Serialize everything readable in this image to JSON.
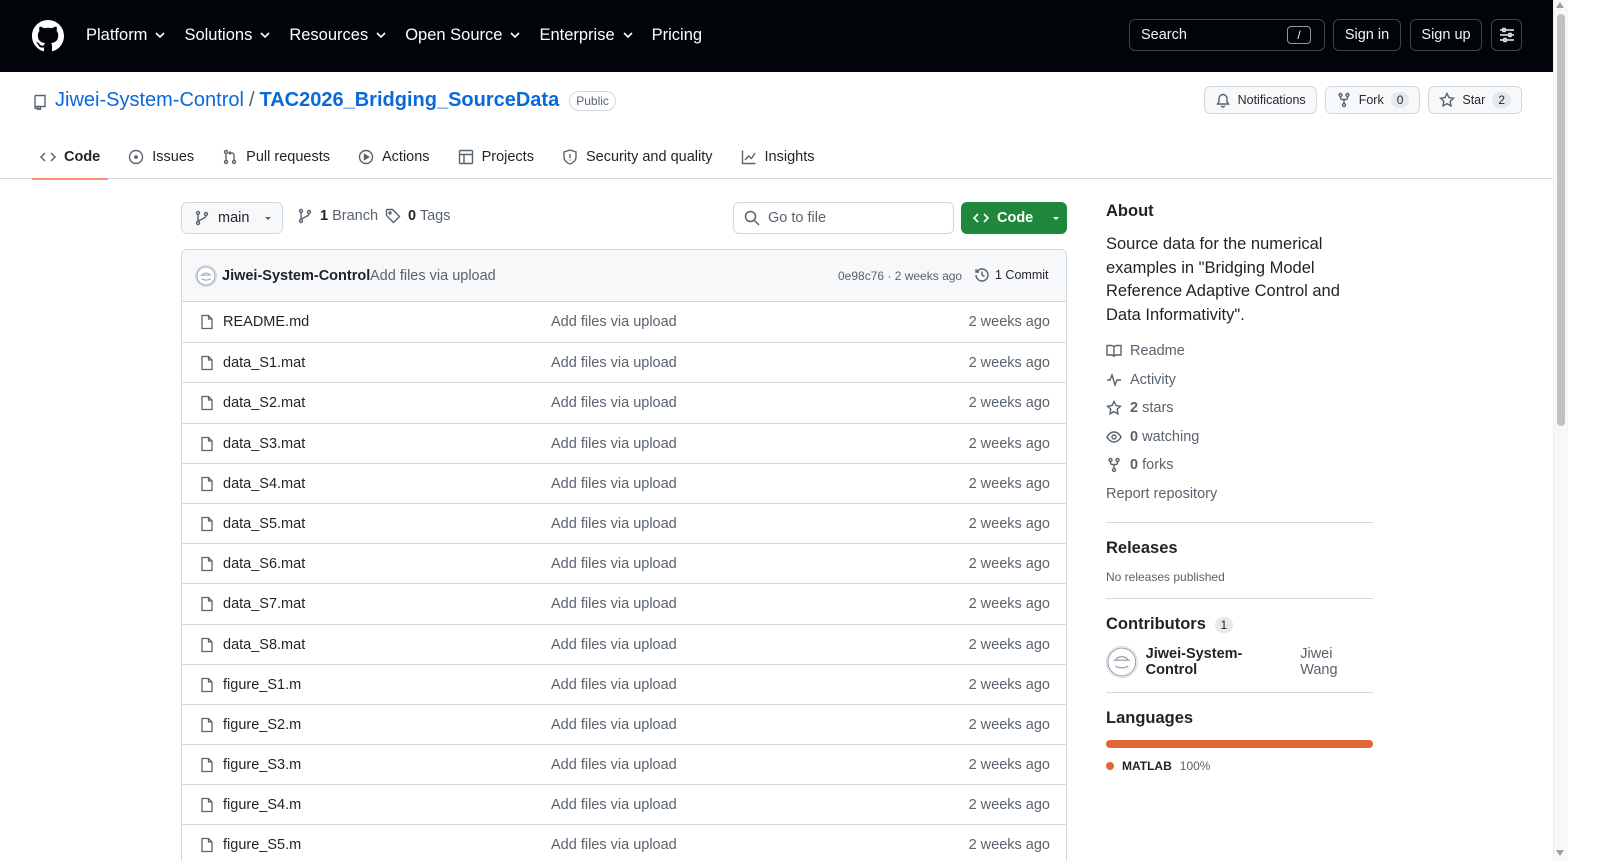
{
  "header": {
    "nav": [
      "Platform",
      "Solutions",
      "Resources",
      "Open Source",
      "Enterprise",
      "Pricing"
    ],
    "search_label": "Search",
    "search_shortcut": "/",
    "signin_label": "Sign in",
    "signup_label": "Sign up"
  },
  "repo": {
    "owner": "Jiwei-System-Control",
    "separator": "/",
    "name": "TAC2026_Bridging_SourceData",
    "visibility": "Public",
    "notifications_label": "Notifications",
    "fork_label": "Fork",
    "fork_count": "0",
    "star_label": "Star",
    "star_count": "2"
  },
  "tabs": [
    "Code",
    "Issues",
    "Pull requests",
    "Actions",
    "Projects",
    "Security and quality",
    "Insights"
  ],
  "toolbar": {
    "branch": "main",
    "branch_count": "1",
    "branch_label": "Branch",
    "tag_count": "0",
    "tag_label": "Tags",
    "goto_placeholder": "Go to file",
    "code_label": "Code"
  },
  "latest_commit": {
    "author": "Jiwei-System-Control",
    "message": "Add files via upload",
    "sha_age": "0e98c76 · 2 weeks ago",
    "commits_label": "1 Commit"
  },
  "files": [
    {
      "name": "README.md",
      "message": "Add files via upload",
      "age": "2 weeks ago"
    },
    {
      "name": "data_S1.mat",
      "message": "Add files via upload",
      "age": "2 weeks ago"
    },
    {
      "name": "data_S2.mat",
      "message": "Add files via upload",
      "age": "2 weeks ago"
    },
    {
      "name": "data_S3.mat",
      "message": "Add files via upload",
      "age": "2 weeks ago"
    },
    {
      "name": "data_S4.mat",
      "message": "Add files via upload",
      "age": "2 weeks ago"
    },
    {
      "name": "data_S5.mat",
      "message": "Add files via upload",
      "age": "2 weeks ago"
    },
    {
      "name": "data_S6.mat",
      "message": "Add files via upload",
      "age": "2 weeks ago"
    },
    {
      "name": "data_S7.mat",
      "message": "Add files via upload",
      "age": "2 weeks ago"
    },
    {
      "name": "data_S8.mat",
      "message": "Add files via upload",
      "age": "2 weeks ago"
    },
    {
      "name": "figure_S1.m",
      "message": "Add files via upload",
      "age": "2 weeks ago"
    },
    {
      "name": "figure_S2.m",
      "message": "Add files via upload",
      "age": "2 weeks ago"
    },
    {
      "name": "figure_S3.m",
      "message": "Add files via upload",
      "age": "2 weeks ago"
    },
    {
      "name": "figure_S4.m",
      "message": "Add files via upload",
      "age": "2 weeks ago"
    },
    {
      "name": "figure_S5.m",
      "message": "Add files via upload",
      "age": "2 weeks ago"
    }
  ],
  "sidebar": {
    "about_title": "About",
    "about_text": "Source data for the numerical examples in \"Bridging Model Reference Adaptive Control and Data Informativity\".",
    "readme": "Readme",
    "activity": "Activity",
    "stars_count": "2",
    "stars_label": "stars",
    "watching_count": "0",
    "watching_label": "watching",
    "forks_count": "0",
    "forks_label": "forks",
    "report": "Report repository",
    "releases_title": "Releases",
    "releases_text": "No releases published",
    "contributors_title": "Contributors",
    "contributors_count": "1",
    "contributor_login": "Jiwei-System-Control",
    "contributor_name": "Jiwei Wang",
    "languages_title": "Languages",
    "language_name": "MATLAB",
    "language_percent": "100%",
    "language_color": "#e16737"
  }
}
